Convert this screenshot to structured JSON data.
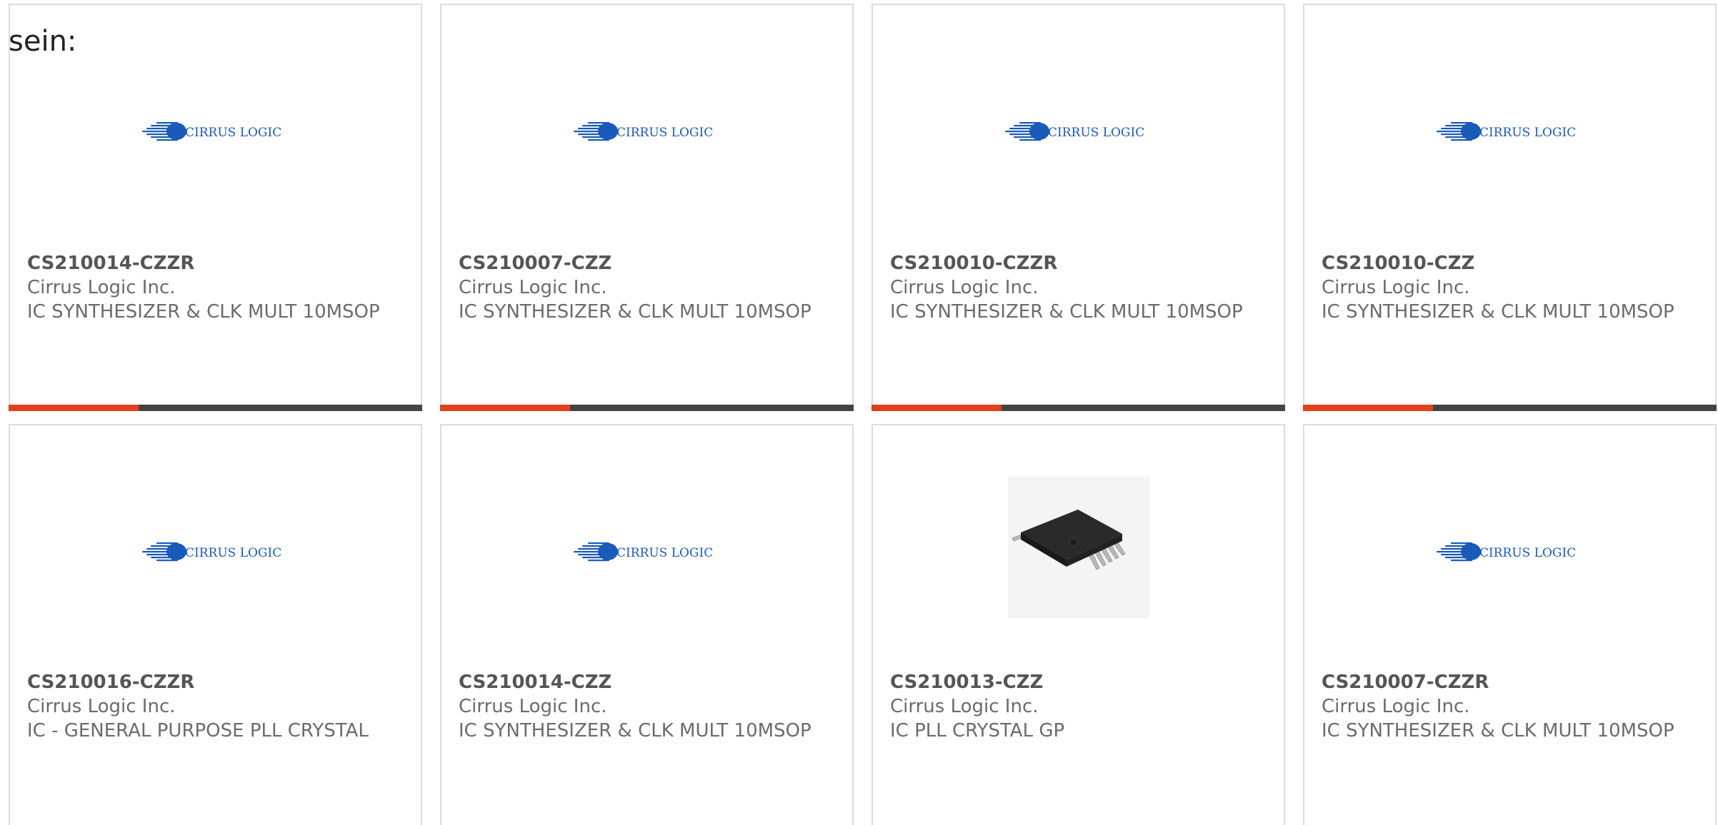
{
  "lead_text": "sein:",
  "colors": {
    "accent": "#e2401c",
    "bar": "#444444",
    "logo_blue": "#1a5ab8"
  },
  "cards": [
    {
      "part_number": "CS210014-CZZR",
      "manufacturer": "Cirrus Logic Inc.",
      "description": "IC SYNTHESIZER & CLK MULT 10MSOP",
      "image": "cirrus-logic-logo"
    },
    {
      "part_number": "CS210007-CZZ",
      "manufacturer": "Cirrus Logic Inc.",
      "description": "IC SYNTHESIZER & CLK MULT 10MSOP",
      "image": "cirrus-logic-logo"
    },
    {
      "part_number": "CS210010-CZZR",
      "manufacturer": "Cirrus Logic Inc.",
      "description": "IC SYNTHESIZER & CLK MULT 10MSOP",
      "image": "cirrus-logic-logo"
    },
    {
      "part_number": "CS210010-CZZ",
      "manufacturer": "Cirrus Logic Inc.",
      "description": "IC SYNTHESIZER & CLK MULT 10MSOP",
      "image": "cirrus-logic-logo"
    },
    {
      "part_number": "CS210016-CZZR",
      "manufacturer": "Cirrus Logic Inc.",
      "description": "IC - GENERAL PURPOSE PLL CRYSTAL",
      "image": "cirrus-logic-logo"
    },
    {
      "part_number": "CS210014-CZZ",
      "manufacturer": "Cirrus Logic Inc.",
      "description": "IC SYNTHESIZER & CLK MULT 10MSOP",
      "image": "cirrus-logic-logo"
    },
    {
      "part_number": "CS210013-CZZ",
      "manufacturer": "Cirrus Logic Inc.",
      "description": "IC PLL CRYSTAL GP",
      "image": "msop-chip-photo"
    },
    {
      "part_number": "CS210007-CZZR",
      "manufacturer": "Cirrus Logic Inc.",
      "description": "IC SYNTHESIZER & CLK MULT 10MSOP",
      "image": "cirrus-logic-logo"
    }
  ],
  "logo": {
    "text": "CIRRUS LOGIC"
  }
}
